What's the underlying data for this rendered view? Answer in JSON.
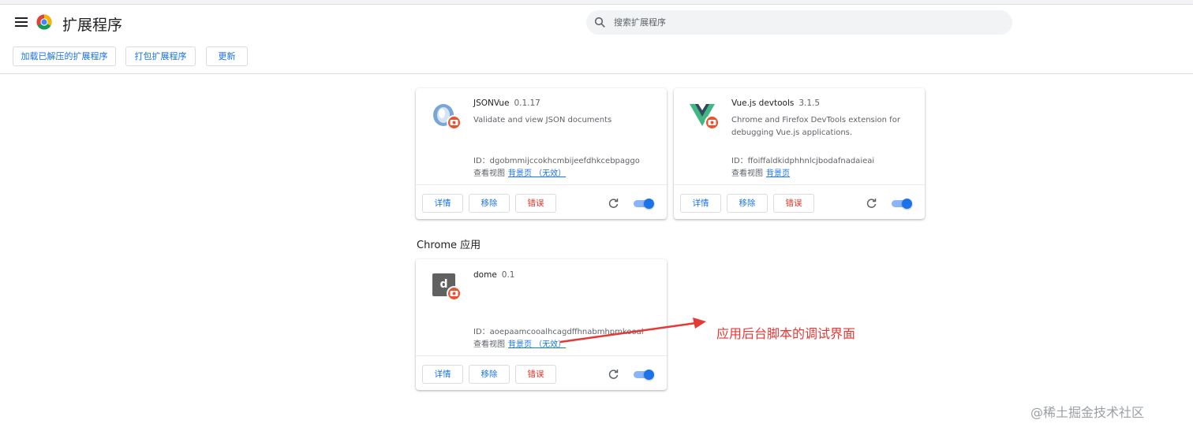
{
  "header": {
    "title": "扩展程序",
    "search_placeholder": "搜索扩展程序"
  },
  "toolbar": {
    "load_unpacked": "加载已解压的扩展程序",
    "pack": "打包扩展程序",
    "update": "更新"
  },
  "extensions": [
    {
      "name": "JSONVue",
      "version": "0.1.17",
      "description": "Validate and view JSON documents",
      "id": "ID：dgobmmijccokhcmbijeefdhkcebpaggo",
      "view_label": "查看视图",
      "view_link": "背景页 （无效）",
      "details": "详情",
      "remove": "移除",
      "errors": "错误",
      "enabled": true
    },
    {
      "name": "Vue.js devtools",
      "version": "3.1.5",
      "description": "Chrome and Firefox DevTools extension for debugging Vue.js applications.",
      "id": "ID：ffoiffaldkidphhnlcjbodafnadaieai",
      "view_label": "查看视图",
      "view_link": "背景页",
      "details": "详情",
      "remove": "移除",
      "errors": "错误",
      "enabled": true
    }
  ],
  "apps_section_title": "Chrome 应用",
  "apps": [
    {
      "icon_letter": "d",
      "name": "dome",
      "version": "0.1",
      "id": "ID：aoepaamcooalhcagdffhnabmhpmkooal",
      "view_label": "查看视图",
      "view_link": "背景页 （无效）",
      "details": "详情",
      "remove": "移除",
      "errors": "错误",
      "enabled": true
    }
  ],
  "annotation": "应用后台脚本的调试界面",
  "watermark": "@稀土掘金技术社区",
  "colors": {
    "accent": "#1a73e8",
    "error": "#d93025",
    "annotation": "#e53935",
    "badge": "#e8542f"
  }
}
